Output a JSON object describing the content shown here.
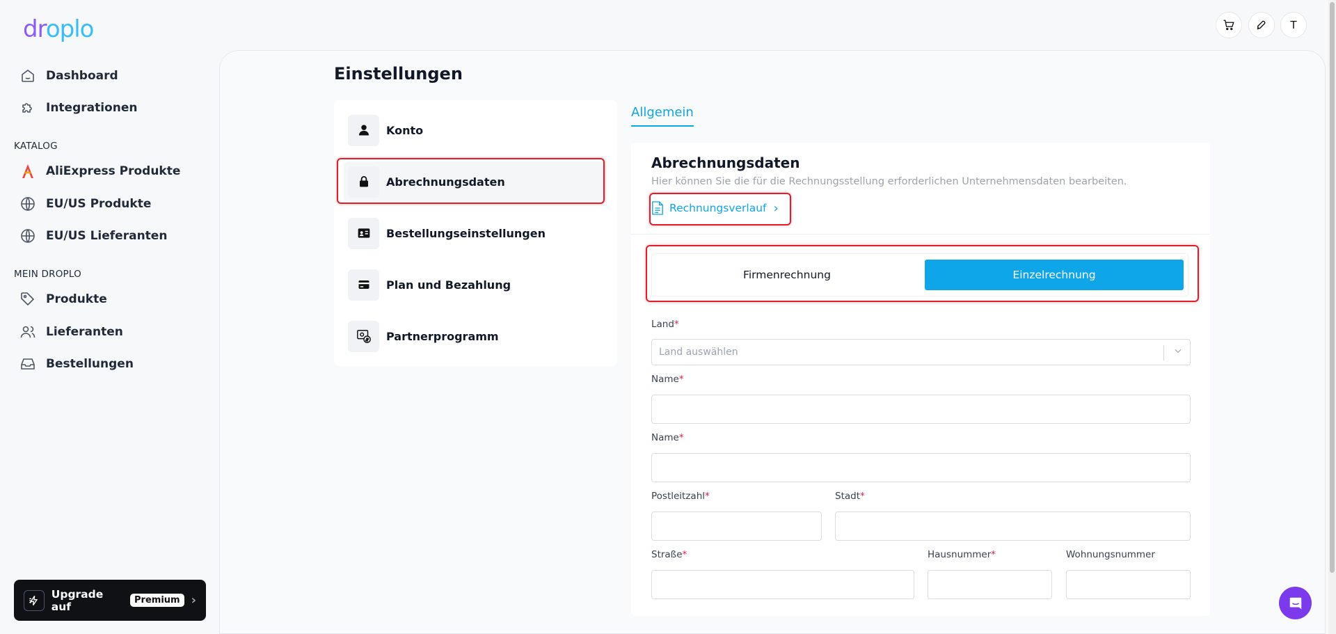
{
  "logo": {
    "part1": "dr",
    "part2": "oplo"
  },
  "sidebar": {
    "items_top": [
      {
        "label": "Dashboard"
      },
      {
        "label": "Integrationen"
      }
    ],
    "section_catalog": "KATALOG",
    "items_catalog": [
      {
        "label": "AliExpress Produkte"
      },
      {
        "label": "EU/US Produkte"
      },
      {
        "label": "EU/US Lieferanten"
      }
    ],
    "section_mine": "MEIN DROPLO",
    "items_mine": [
      {
        "label": "Produkte"
      },
      {
        "label": "Lieferanten"
      },
      {
        "label": "Bestellungen"
      }
    ],
    "upgrade": {
      "label": "Upgrade auf",
      "badge": "Premium"
    }
  },
  "topbar": {
    "avatar_initial": "T"
  },
  "page": {
    "title": "Einstellungen"
  },
  "settings_menu": [
    {
      "label": "Konto"
    },
    {
      "label": "Abrechnungsdaten"
    },
    {
      "label": "Bestellungseinstellungen"
    },
    {
      "label": "Plan und Bezahlung"
    },
    {
      "label": "Partnerprogramm"
    }
  ],
  "tabs": {
    "general": "Allgemein"
  },
  "billing": {
    "title": "Abrechnungsdaten",
    "subtitle": "Hier können Sie die für die Rechnungsstellung erforderlichen Unternehmensdaten bearbeiten.",
    "history_link": "Rechnungsverlauf",
    "toggle": {
      "company": "Firmenrechnung",
      "individual": "Einzelrechnung",
      "selected": "individual"
    },
    "fields": {
      "country": {
        "label": "Land",
        "placeholder": "Land auswählen"
      },
      "name1": {
        "label": "Name",
        "value": ""
      },
      "name2": {
        "label": "Name",
        "value": ""
      },
      "zip": {
        "label": "Postleitzahl",
        "value": ""
      },
      "city": {
        "label": "Stadt",
        "value": ""
      },
      "street": {
        "label": "Straße",
        "value": ""
      },
      "house_no": {
        "label": "Hausnummer",
        "value": ""
      },
      "apt_no": {
        "label": "Wohnungsnummer",
        "value": ""
      },
      "required_mark": "*"
    }
  },
  "colors": {
    "accent": "#0ea5e9",
    "brand_purple": "#7c3aed",
    "highlight": "#e11d2a"
  }
}
